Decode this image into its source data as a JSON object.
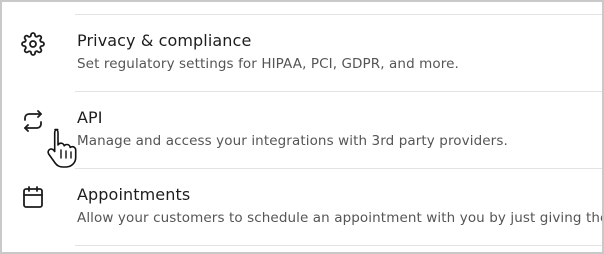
{
  "settings_list": {
    "items": [
      {
        "id": "privacy",
        "icon": "gear-icon",
        "title": "Privacy & compliance",
        "description": "Set regulatory settings for HIPAA, PCI, GDPR, and more."
      },
      {
        "id": "api",
        "icon": "arrows-exchange-icon",
        "title": "API",
        "description": "Manage and access your integrations with 3rd party providers."
      },
      {
        "id": "appointments",
        "icon": "calendar-icon",
        "title": "Appointments",
        "description": "Allow your customers to schedule an appointment with you by just giving them a link."
      }
    ]
  },
  "cursor": {
    "icon": "hand-pointer-icon"
  },
  "colors": {
    "title": "#1d1d1d",
    "description": "#555555",
    "divider": "#e3e3e3",
    "border": "#c9c9c9"
  }
}
